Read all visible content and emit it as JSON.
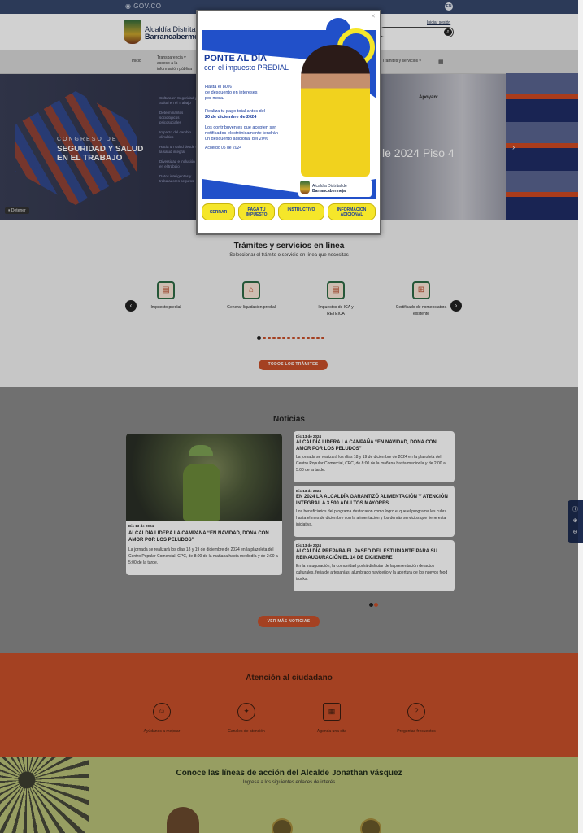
{
  "govbar": {
    "label": "GOV.CO",
    "lang": "EN"
  },
  "header": {
    "brand_line1": "Alcaldía Distrital",
    "brand_line2": "Barrancabermeja",
    "login": "Iniciar sesión"
  },
  "nav": {
    "items": [
      "Inicio",
      "Transparencia y acceso a la información pública",
      "Trámites y servicios"
    ]
  },
  "hero": {
    "line1": "CONGRESO DE",
    "line2": "SEGURIDAD Y SALUD",
    "line3": "EN EL TRABAJO",
    "apoyan": "Apoyan:",
    "big": "le 2024 Piso 4",
    "stop": "Detener",
    "list": [
      "Cultura en Seguridad y Salud en el Trabajo",
      "Determinantes sociológicos psicosociales",
      "Impacto del cambio climático",
      "Hacia un salud desde de la salud integral",
      "Diversidad e inclusión en el trabajo",
      "Datos inteligentes y trabajadores seguros"
    ]
  },
  "tramites": {
    "title": "Trámites y servicios en línea",
    "subtitle": "Seleccionar el trámite o servicio en línea que necesitas",
    "services": [
      {
        "label": "Impuesto predial",
        "icon": "building-doc-icon"
      },
      {
        "label": "Generar liquidación predial",
        "icon": "house-coin-icon"
      },
      {
        "label": "Impuestos de ICA y RETEICA",
        "icon": "building-doc-icon"
      },
      {
        "label": "Certificado de nomenclatura existente",
        "icon": "address-sign-icon"
      }
    ],
    "button": "TODOS LOS TRÁMITES"
  },
  "noticias": {
    "title": "Noticias",
    "main": {
      "date": "Dic 13 de 2024",
      "head": "ALCALDÍA LIDERA LA CAMPAÑA “EN NAVIDAD, DONA CON AMOR POR LOS PELUDOS”",
      "body": "La jornada se realizará los días 18 y 19 de diciembre de 2024 en la plazoleta del Centro Popular Comercial, CPC, de 8:00 de la mañana hasta mediodía y de 2:00 a 5:00 de la tarde."
    },
    "cards": [
      {
        "date": "Dic 13 de 2024",
        "head": "ALCALDÍA LIDERA LA CAMPAÑA “EN NAVIDAD, DONA CON AMOR POR LOS PELUDOS”",
        "body": "La jornada se realizará los días 18 y 19 de diciembre de 2024 en la plazoleta del Centro Popular Comercial, CPC, de 8:00 de la mañana hasta mediodía y de 2:00 a 5:00 de la tarde."
      },
      {
        "date": "Dic 13 de 2024",
        "head": "EN 2024 LA ALCALDÍA GARANTIZÓ ALIMENTACIÓN Y ATENCIÓN INTEGRAL A 3.500 ADULTOS MAYORES",
        "body": "Los beneficiarios del programa destacaron como logro el que el programa les cubra hasta el mes de diciembre con la alimentación y los demás servicios que tiene esta iniciativa."
      },
      {
        "date": "Dic 13 de 2024",
        "head": "ALCALDÍA PREPARA EL PASEO DEL ESTUDIANTE PARA SU REINAUGURACIÓN EL 14 DE DICIEMBRE",
        "body": "En la inauguración, la comunidad podrá disfrutar de la presentación de actos culturales, feria de artesanías, alumbrado navideño y la apertura de los nuevos food trucks."
      }
    ],
    "button": "VER MÁS NOTICIAS"
  },
  "atencion": {
    "title": "Atención al ciudadano",
    "items": [
      {
        "label": "Ayúdanos a mejorar",
        "icon": "user-feedback-icon"
      },
      {
        "label": "Canales de atención",
        "icon": "channels-icon"
      },
      {
        "label": "Agenda una cita",
        "icon": "calendar-icon"
      },
      {
        "label": "Preguntas frecuentes",
        "icon": "user-question-icon"
      }
    ]
  },
  "lineas": {
    "title": "Conoce las líneas de acción del Alcalde Jonathan vásquez",
    "subtitle": "Ingresa a los siguientes enlaces de interés"
  },
  "modal": {
    "t1": "PONTE AL DÍA",
    "t2": "con el impuesto PREDIAL",
    "t3a": "Hasta el 80%",
    "t3b": "de descuento en intereses",
    "t3c": "por mora.",
    "t4a": "Realiza tu pago total antes del",
    "t4b": "20 de diciembre de 2024",
    "t5a": "Los contribuyentes que acepten ser",
    "t5b": "notificados electrónicamente tendrán",
    "t5c": "un descuento adicional del 20%",
    "t6": "Acuerdo 05 de 2024",
    "logo1": "Alcaldía Distrital de",
    "logo2": "Barrancabermeja",
    "buttons": [
      "CERRAR",
      "PAGA TU IMPUESTO",
      "INSTRUCTIVO",
      "INFORMACIÓN ADICIONAL"
    ]
  }
}
